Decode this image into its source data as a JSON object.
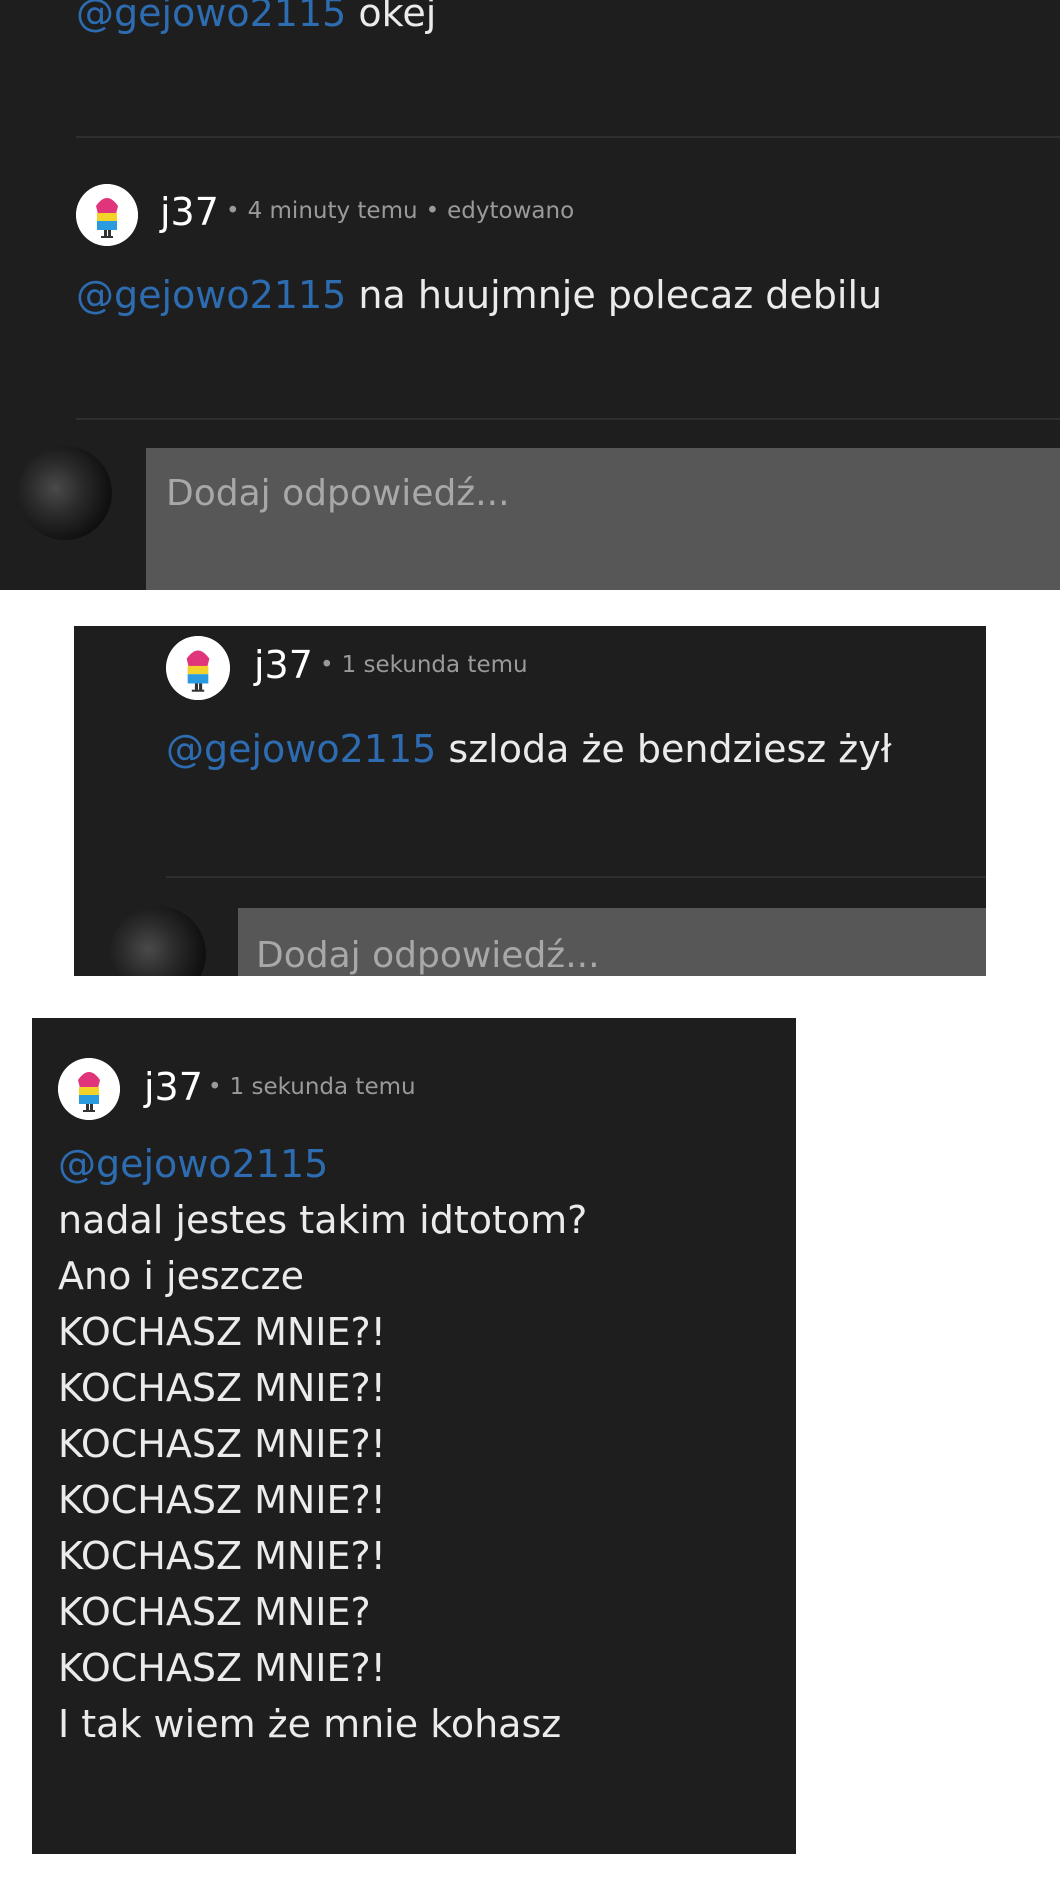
{
  "panel1": {
    "top_comment": {
      "mention": "@gejowo2115",
      "text": " okej"
    },
    "comment": {
      "username": "j37",
      "timestamp": "4 minuty temu",
      "edited": "edytowano",
      "mention": "@gejowo2115",
      "text": " na huujmnje polecaz debilu"
    },
    "reply_placeholder": "Dodaj odpowiedź..."
  },
  "panel2": {
    "comment": {
      "username": "j37",
      "timestamp": "1 sekunda temu",
      "mention": "@gejowo2115",
      "text": " szloda że bendziesz żył"
    },
    "reply_placeholder": "Dodaj odpowiedź..."
  },
  "panel3": {
    "comment": {
      "username": "j37",
      "timestamp": "1 sekunda temu",
      "mention": "@gejowo2115",
      "lines": [
        "nadal jestes takim idtotom?",
        "Ano i jeszcze",
        "KOCHASZ MNIE?!",
        "KOCHASZ MNIE?!",
        "KOCHASZ MNIE?!",
        "KOCHASZ MNIE?!",
        "KOCHASZ MNIE?!",
        "KOCHASZ MNIE?",
        "KOCHASZ MNIE?!",
        "I tak wiem że mnie kohasz"
      ]
    }
  },
  "colors": {
    "panel_bg": "#1e1e1e",
    "mention": "#2d6cb0",
    "reply_box": "#575757",
    "meta_text": "#9a9a9a"
  },
  "icons": {
    "user_avatar": "popsicle-avatar-icon",
    "current_user_avatar": "dark-photo-avatar"
  }
}
